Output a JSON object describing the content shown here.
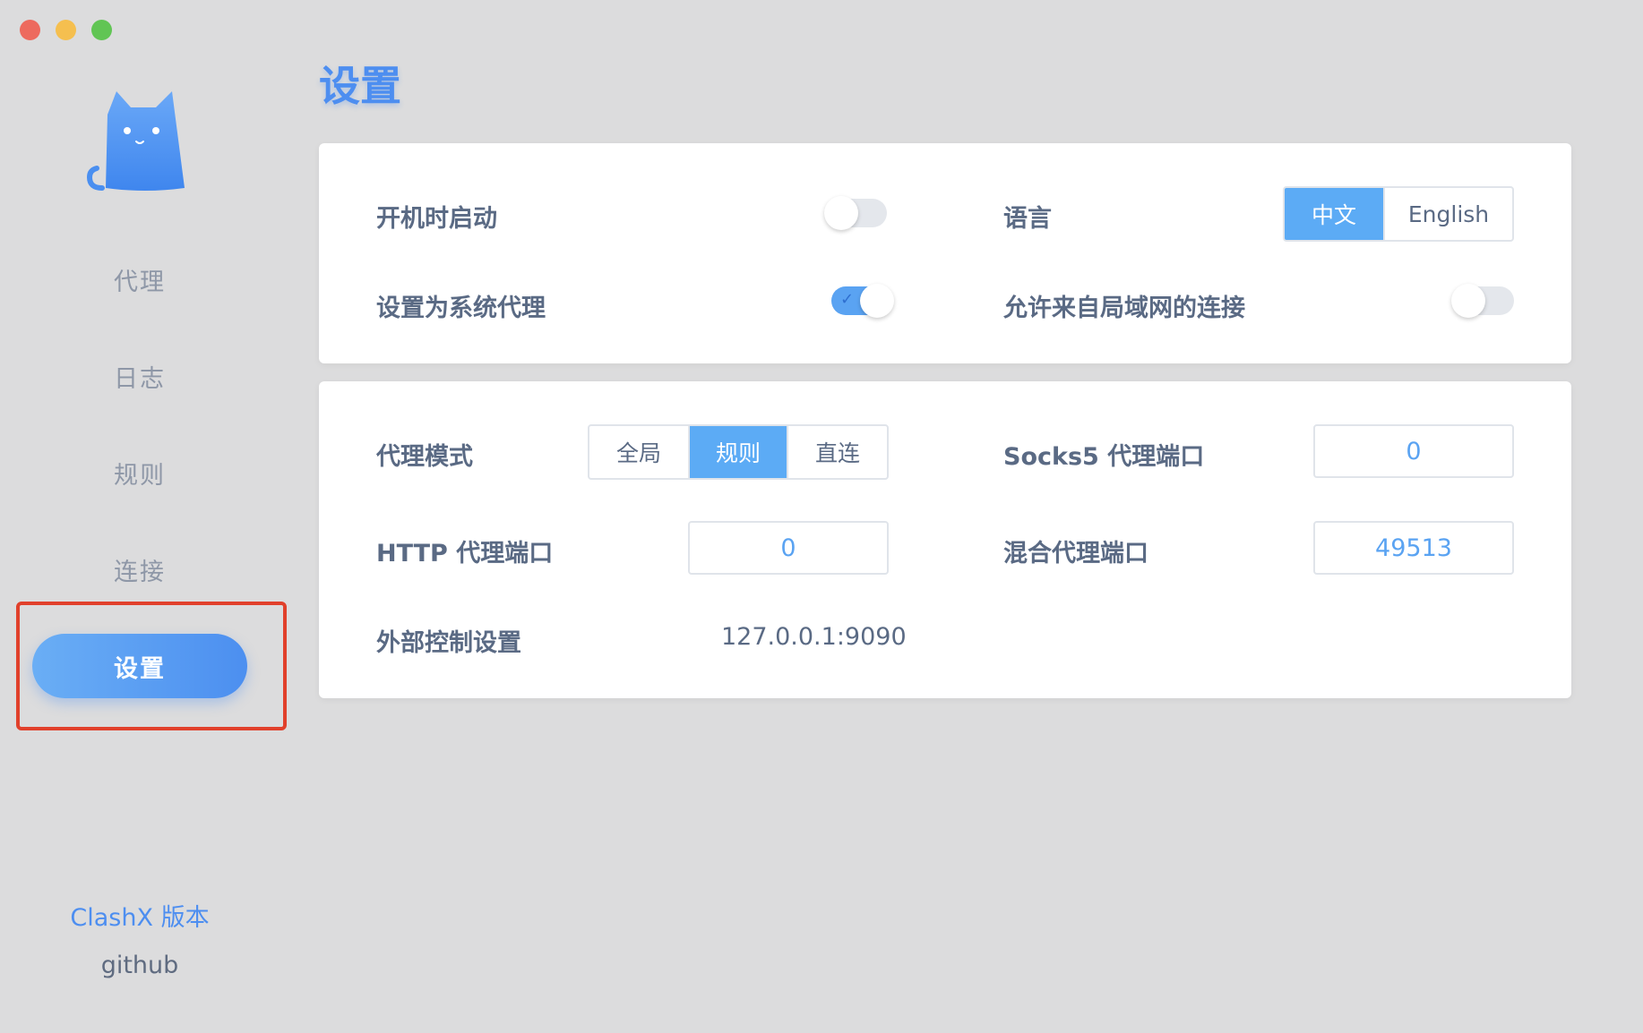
{
  "window": {
    "traffic_lights": [
      "close",
      "minimize",
      "zoom"
    ]
  },
  "sidebar": {
    "items": [
      {
        "label": "代理"
      },
      {
        "label": "日志"
      },
      {
        "label": "规则"
      },
      {
        "label": "连接"
      },
      {
        "label": "设置",
        "active": true
      }
    ],
    "version_link": "ClashX 版本",
    "github_link": "github"
  },
  "main": {
    "title": "设置",
    "general": {
      "launch_at_login": {
        "label": "开机时启动",
        "enabled": false
      },
      "system_proxy": {
        "label": "设置为系统代理",
        "enabled": true
      },
      "language": {
        "label": "语言",
        "options": [
          "中文",
          "English"
        ],
        "selected": "中文"
      },
      "allow_lan": {
        "label": "允许来自局域网的连接",
        "enabled": false
      }
    },
    "proxy": {
      "mode": {
        "label": "代理模式",
        "options": [
          "全局",
          "规则",
          "直连"
        ],
        "selected": "规则"
      },
      "socks5_port": {
        "label": "Socks5 代理端口",
        "value": "0"
      },
      "http_port": {
        "label": "HTTP 代理端口",
        "value": "0"
      },
      "mixed_port": {
        "label": "混合代理端口",
        "value": "49513"
      },
      "external_controller": {
        "label": "外部控制设置",
        "value": "127.0.0.1:9090"
      }
    }
  },
  "colors": {
    "accent": "#4d8ef0",
    "selected_segment": "#5cabf5",
    "highlight_border": "#e1402b",
    "background": "#dcdcdd"
  }
}
